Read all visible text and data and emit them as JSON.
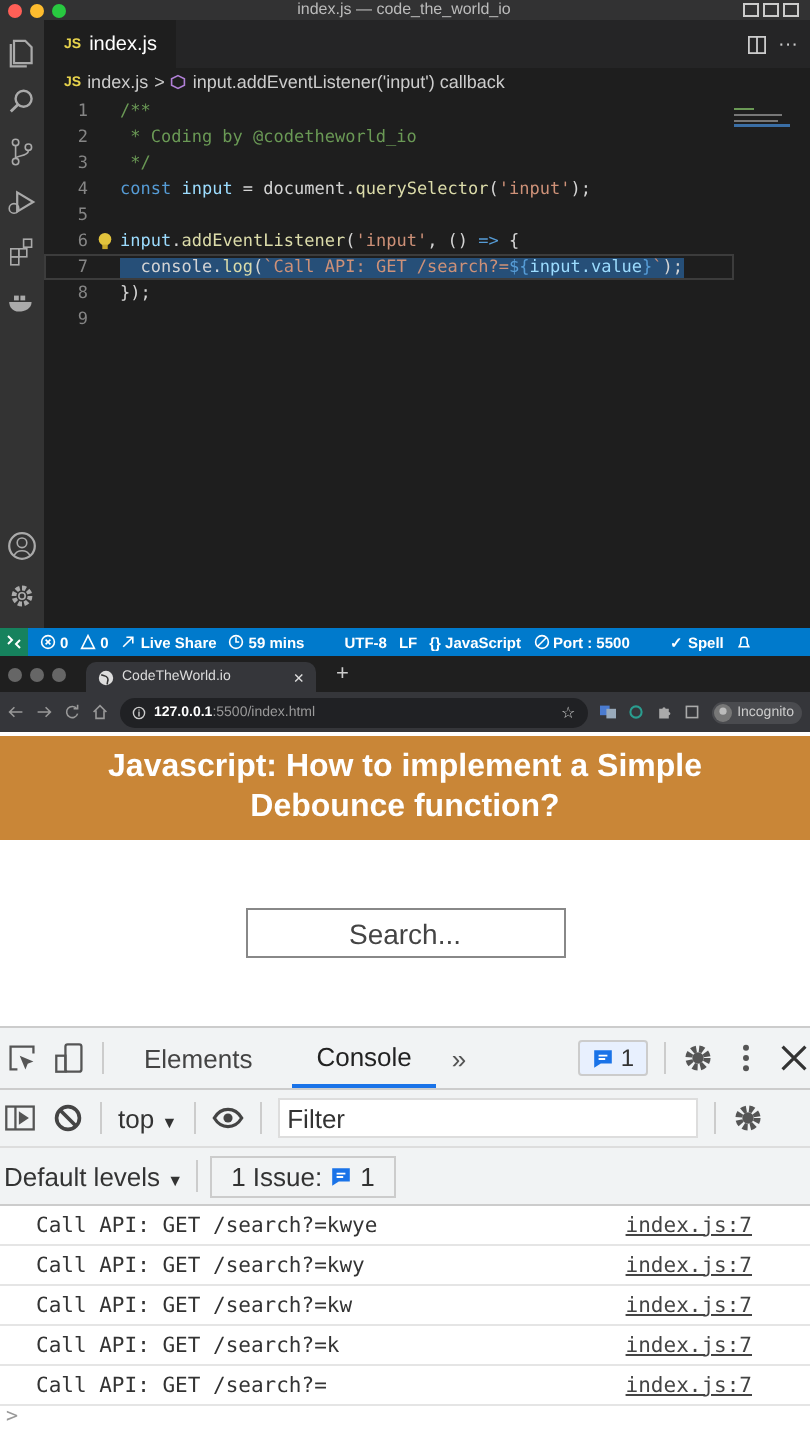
{
  "editor": {
    "window_title": "index.js — code_the_world_io",
    "tab": {
      "label": "index.js",
      "badge": "JS",
      "more": "···"
    },
    "breadcrumb": {
      "badge": "JS",
      "file": "index.js",
      "separator": ">",
      "symbol": "input.addEventListener('input') callback"
    },
    "lines": [
      {
        "number": "1",
        "selected": false,
        "lightbulb": false,
        "tokens": [
          {
            "kind": "comment",
            "text": "/**"
          }
        ]
      },
      {
        "number": "2",
        "selected": false,
        "lightbulb": false,
        "tokens": [
          {
            "kind": "comment",
            "text": " * Coding by @codetheworld_io"
          }
        ]
      },
      {
        "number": "3",
        "selected": false,
        "lightbulb": false,
        "tokens": [
          {
            "kind": "comment",
            "text": " */"
          }
        ]
      },
      {
        "number": "4",
        "selected": false,
        "lightbulb": false,
        "tokens": [
          {
            "kind": "keyword",
            "text": "const "
          },
          {
            "kind": "variable",
            "text": "input"
          },
          {
            "kind": "plain",
            "text": " = document."
          },
          {
            "kind": "function",
            "text": "querySelector"
          },
          {
            "kind": "plain",
            "text": "("
          },
          {
            "kind": "string",
            "text": "'input'"
          },
          {
            "kind": "plain",
            "text": ");"
          }
        ]
      },
      {
        "number": "5",
        "selected": false,
        "lightbulb": false
      },
      {
        "number": "6",
        "selected": false,
        "lightbulb": true,
        "tokens": [
          {
            "kind": "variable",
            "text": "input"
          },
          {
            "kind": "plain",
            "text": "."
          },
          {
            "kind": "function",
            "text": "addEventListener"
          },
          {
            "kind": "plain",
            "text": "("
          },
          {
            "kind": "string",
            "text": "'input'"
          },
          {
            "kind": "plain",
            "text": ", () "
          },
          {
            "kind": "keyword",
            "text": "=>"
          },
          {
            "kind": "plain",
            "text": " {"
          }
        ]
      },
      {
        "number": "7",
        "selected": true,
        "lightbulb": false,
        "tokens": [
          {
            "kind": "plain",
            "text": "  console."
          },
          {
            "kind": "function",
            "text": "log"
          },
          {
            "kind": "plain",
            "text": "("
          },
          {
            "kind": "string",
            "text": "`Call API: GET /search?="
          },
          {
            "kind": "keyword",
            "text": "${"
          },
          {
            "kind": "variable",
            "text": "input.value"
          },
          {
            "kind": "keyword",
            "text": "}"
          },
          {
            "kind": "string",
            "text": "`"
          },
          {
            "kind": "plain",
            "text": ");"
          }
        ]
      },
      {
        "number": "8",
        "selected": false,
        "lightbulb": false,
        "tokens": [
          {
            "kind": "plain",
            "text": "});"
          }
        ]
      },
      {
        "number": "9",
        "selected": false,
        "lightbulb": false
      }
    ]
  },
  "status_bar": [
    {
      "kind": "errors",
      "text": "0"
    },
    {
      "kind": "warnings",
      "text": "0"
    },
    {
      "kind": "live-share",
      "text": "Live Share"
    },
    {
      "kind": "timer",
      "text": "59 mins"
    },
    {
      "kind": "plain",
      "text": "UTF-8"
    },
    {
      "kind": "plain",
      "text": "LF"
    },
    {
      "kind": "plain",
      "text": "{} JavaScript"
    },
    {
      "kind": "port",
      "text": "Port : 5500"
    },
    {
      "kind": "plain",
      "text": "✓ Spell"
    },
    {
      "kind": "notifications"
    }
  ],
  "browser": {
    "tab": {
      "title": "CodeTheWorld.io",
      "close": "×"
    },
    "new_tab": "+",
    "url_host": "127.0.0.1",
    "url_path": ":5500/index.html",
    "profile": "Incognito",
    "bookmark": "☆"
  },
  "page": {
    "heading": "Javascript: How to implement a Simple Debounce function?",
    "search": {
      "placeholder": "Search..."
    }
  },
  "devtools": {
    "tabs": [
      {
        "label": "Elements",
        "selected": false
      },
      {
        "label": "Console",
        "selected": true
      }
    ],
    "more": "»",
    "issues_badge": "1",
    "context": "top",
    "context_caret": "▼",
    "levels_caret": "▼",
    "filter": {
      "placeholder": "Filter"
    },
    "levels": "Default levels",
    "issues_label": "1 Issue:",
    "issues_count": "1",
    "messages": [
      {
        "text": "Call API: GET /search?=kwye",
        "source": "index.js:7"
      },
      {
        "text": "Call API: GET /search?=kwy",
        "source": "index.js:7"
      },
      {
        "text": "Call API: GET /search?=kw",
        "source": "index.js:7"
      },
      {
        "text": "Call API: GET /search?=k",
        "source": "index.js:7"
      },
      {
        "text": "Call API: GET /search?=",
        "source": "index.js:7"
      }
    ],
    "prompt": ">"
  }
}
